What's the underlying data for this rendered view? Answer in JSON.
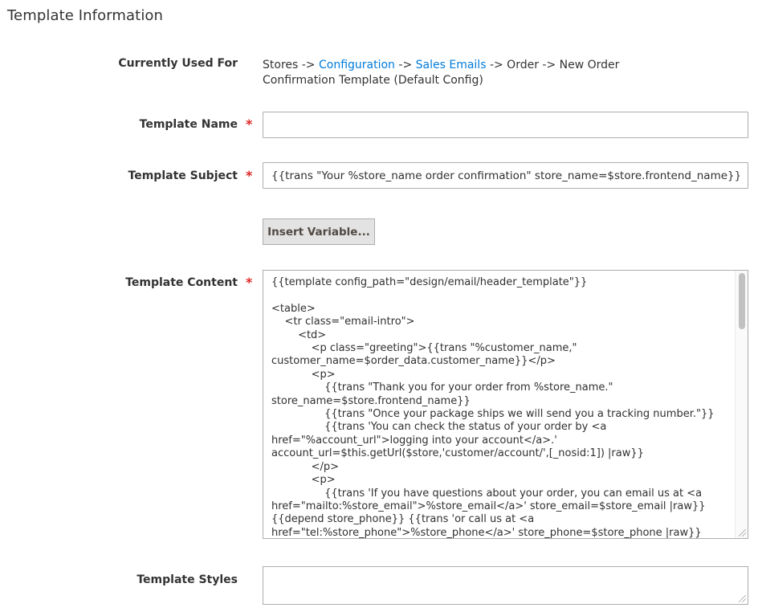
{
  "section": {
    "title": "Template Information"
  },
  "currently_used_for": {
    "label": "Currently Used For",
    "parts": [
      "Stores ->",
      "Configuration",
      "->",
      "Sales Emails",
      "-> Order -> New Order Confirmation Template",
      "(Default Config)"
    ]
  },
  "template_name": {
    "label": "Template Name",
    "required": "*",
    "value": ""
  },
  "template_subject": {
    "label": "Template Subject",
    "required": "*",
    "value": "{{trans \"Your %store_name order confirmation\" store_name=$store.frontend_name}}"
  },
  "insert_variable": {
    "label": "Insert Variable..."
  },
  "template_content": {
    "label": "Template Content",
    "required": "*",
    "value": "{{template config_path=\"design/email/header_template\"}}\n\n<table>\n    <tr class=\"email-intro\">\n        <td>\n            <p class=\"greeting\">{{trans \"%customer_name,\" customer_name=$order_data.customer_name}}</p>\n            <p>\n                {{trans \"Thank you for your order from %store_name.\" store_name=$store.frontend_name}}\n                {{trans \"Once your package ships we will send you a tracking number.\"}}\n                {{trans 'You can check the status of your order by <a href=\"%account_url\">logging into your account</a>.' account_url=$this.getUrl($store,'customer/account/',[_nosid:1]) |raw}}\n            </p>\n            <p>\n                {{trans 'If you have questions about your order, you can email us at <a href=\"mailto:%store_email\">%store_email</a>' store_email=$store_email |raw}}{{depend store_phone}} {{trans 'or call us at <a href=\"tel:%store_phone\">%store_phone</a>' store_phone=$store_phone |raw}}"
  },
  "template_styles": {
    "label": "Template Styles",
    "value": ""
  },
  "colors": {
    "link": "#007bdb",
    "required": "#e22626",
    "border": "#adadad"
  }
}
